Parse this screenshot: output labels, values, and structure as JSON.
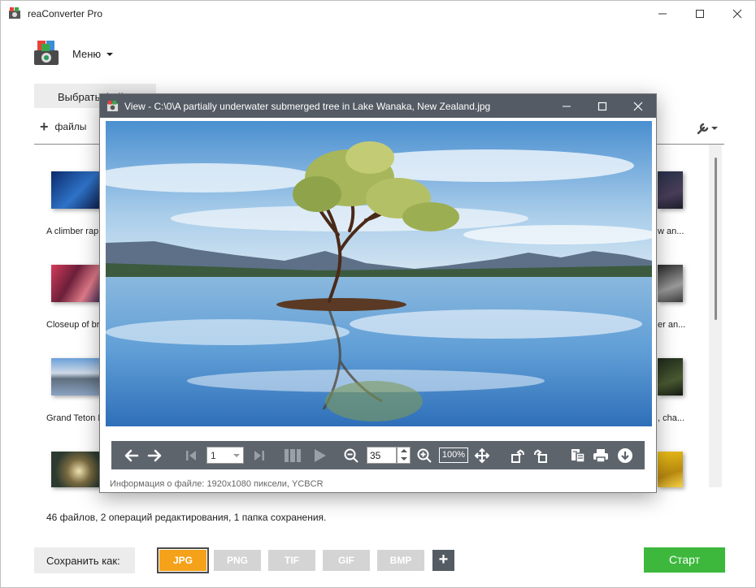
{
  "window": {
    "title": "reaConverter Pro",
    "controls": [
      "minimize-icon",
      "maximize-icon",
      "close-icon"
    ]
  },
  "menu": {
    "label": "Меню"
  },
  "tabs": {
    "select_files": "Выбрать файлы"
  },
  "toolbar": {
    "add_files_label": "файлы",
    "settings_icon": "wrench-icon"
  },
  "file_list": {
    "captions_left": [
      "A climber rapp",
      "Closeup of bru",
      "Grand Teton N"
    ],
    "captions_right": [
      "w an...",
      "er an...",
      ", cha..."
    ]
  },
  "status": {
    "text": "46 файлов, 2 операций редактирования, 1 папка сохранения."
  },
  "footer": {
    "save_as_label": "Сохранить как:",
    "formats": [
      "JPG",
      "PNG",
      "TIF",
      "GIF",
      "BMP"
    ],
    "selected_format": "JPG",
    "add_format_label": "+",
    "start_label": "Старт",
    "colors": {
      "selected_format": "#f5a21a",
      "start": "#3db83d",
      "format_inactive": "#d4d4d4"
    }
  },
  "viewer": {
    "title": "View - C:\\0\\A partially underwater submerged tree in Lake Wanaka, New Zealand.jpg",
    "page_value": "1",
    "zoom_value": "35",
    "zoom_percent_label": "100%",
    "info": "Информация о файле: 1920x1080 пиксели, YCBCR",
    "tools": [
      "arrow-left-icon",
      "arrow-right-icon",
      "first-page-icon",
      "page-select",
      "last-page-icon",
      "slideshow-icon",
      "play-icon",
      "zoom-out-icon",
      "zoom-input",
      "zoom-in-icon",
      "actual-size-button",
      "fit-move-icon",
      "rotate-left-icon",
      "rotate-right-icon",
      "properties-icon",
      "print-icon",
      "download-icon"
    ]
  }
}
